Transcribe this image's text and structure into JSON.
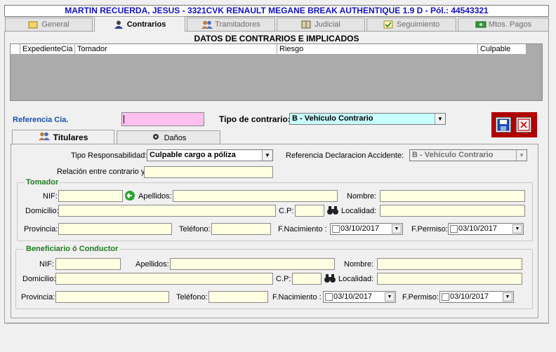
{
  "header": {
    "title": "MARTIN RECUERDA, JESUS - 3321CVK RENAULT MEGANE BREAK AUTHENTIQUE 1.9 D - Pól.: 44543321"
  },
  "tabs": [
    {
      "label": "General"
    },
    {
      "label": "Contrarios"
    },
    {
      "label": "Tramitadores"
    },
    {
      "label": "Judicial"
    },
    {
      "label": "Seguimiento"
    },
    {
      "label": "Mtos. Pagos"
    }
  ],
  "section_title": "DATOS DE CONTRARIOS E IMPLICADOS",
  "grid": {
    "columns": [
      "ExpedienteCia",
      "Tomador",
      "Riesgo",
      "Culpable"
    ]
  },
  "form": {
    "ref_cia_label": "Referencia Cía. Contrario",
    "ref_cia_value": "",
    "tipo_contrario_label": "Tipo de contrario:",
    "tipo_contrario_value": "B - Vehículo Contrario"
  },
  "subtabs": [
    {
      "label": "Titulares"
    },
    {
      "label": "Daños"
    }
  ],
  "titulares": {
    "tipo_resp_label": "Tipo Responsabilidad:",
    "tipo_resp_value": "Culpable cargo a póliza",
    "ref_decl_label": "Referencia Declaracion Accidente:",
    "ref_decl_value": "B - Vehículo Contrario",
    "relacion_label": "Relación entre contrario y",
    "relacion_value": ""
  },
  "tomador": {
    "title": "Tomador",
    "nif_label": "NIF:",
    "apellidos_label": "Apellidos:",
    "nombre_label": "Nombre:",
    "domicilio_label": "Domicilio:",
    "cp_label": "C.P:",
    "localidad_label": "Localidad:",
    "provincia_label": "Provincia:",
    "telefono_label": "Teléfono:",
    "fnac_label": "F.Nacimiento :",
    "fnac_value": "03/10/2017",
    "fperm_label": "F.Permiso:",
    "fperm_value": "03/10/2017"
  },
  "beneficiario": {
    "title": "Beneficiario ó Conductor",
    "nif_label": "NIF:",
    "apellidos_label": "Apellidos:",
    "nombre_label": "Nombre:",
    "domicilio_label": "Domicilio:",
    "cp_label": "C.P:",
    "localidad_label": "Localidad:",
    "provincia_label": "Provincia:",
    "telefono_label": "Teléfono:",
    "fnac_label": "F.Nacimiento :",
    "fnac_value": "03/10/2017",
    "fperm_label": "F.Permiso:",
    "fperm_value": "03/10/2017"
  },
  "icons": {
    "save": "floppy-disk-icon",
    "cancel": "close-icon",
    "go": "green-arrow-icon",
    "search": "binoculars-icon"
  },
  "colors": {
    "title_text": "#1010c8",
    "ref_field": "#ffc0f0",
    "combo_highlight": "#c8ffff",
    "field_bg": "#ffffe1",
    "group_title": "#1f7a1f",
    "action_frame": "#b00000"
  }
}
